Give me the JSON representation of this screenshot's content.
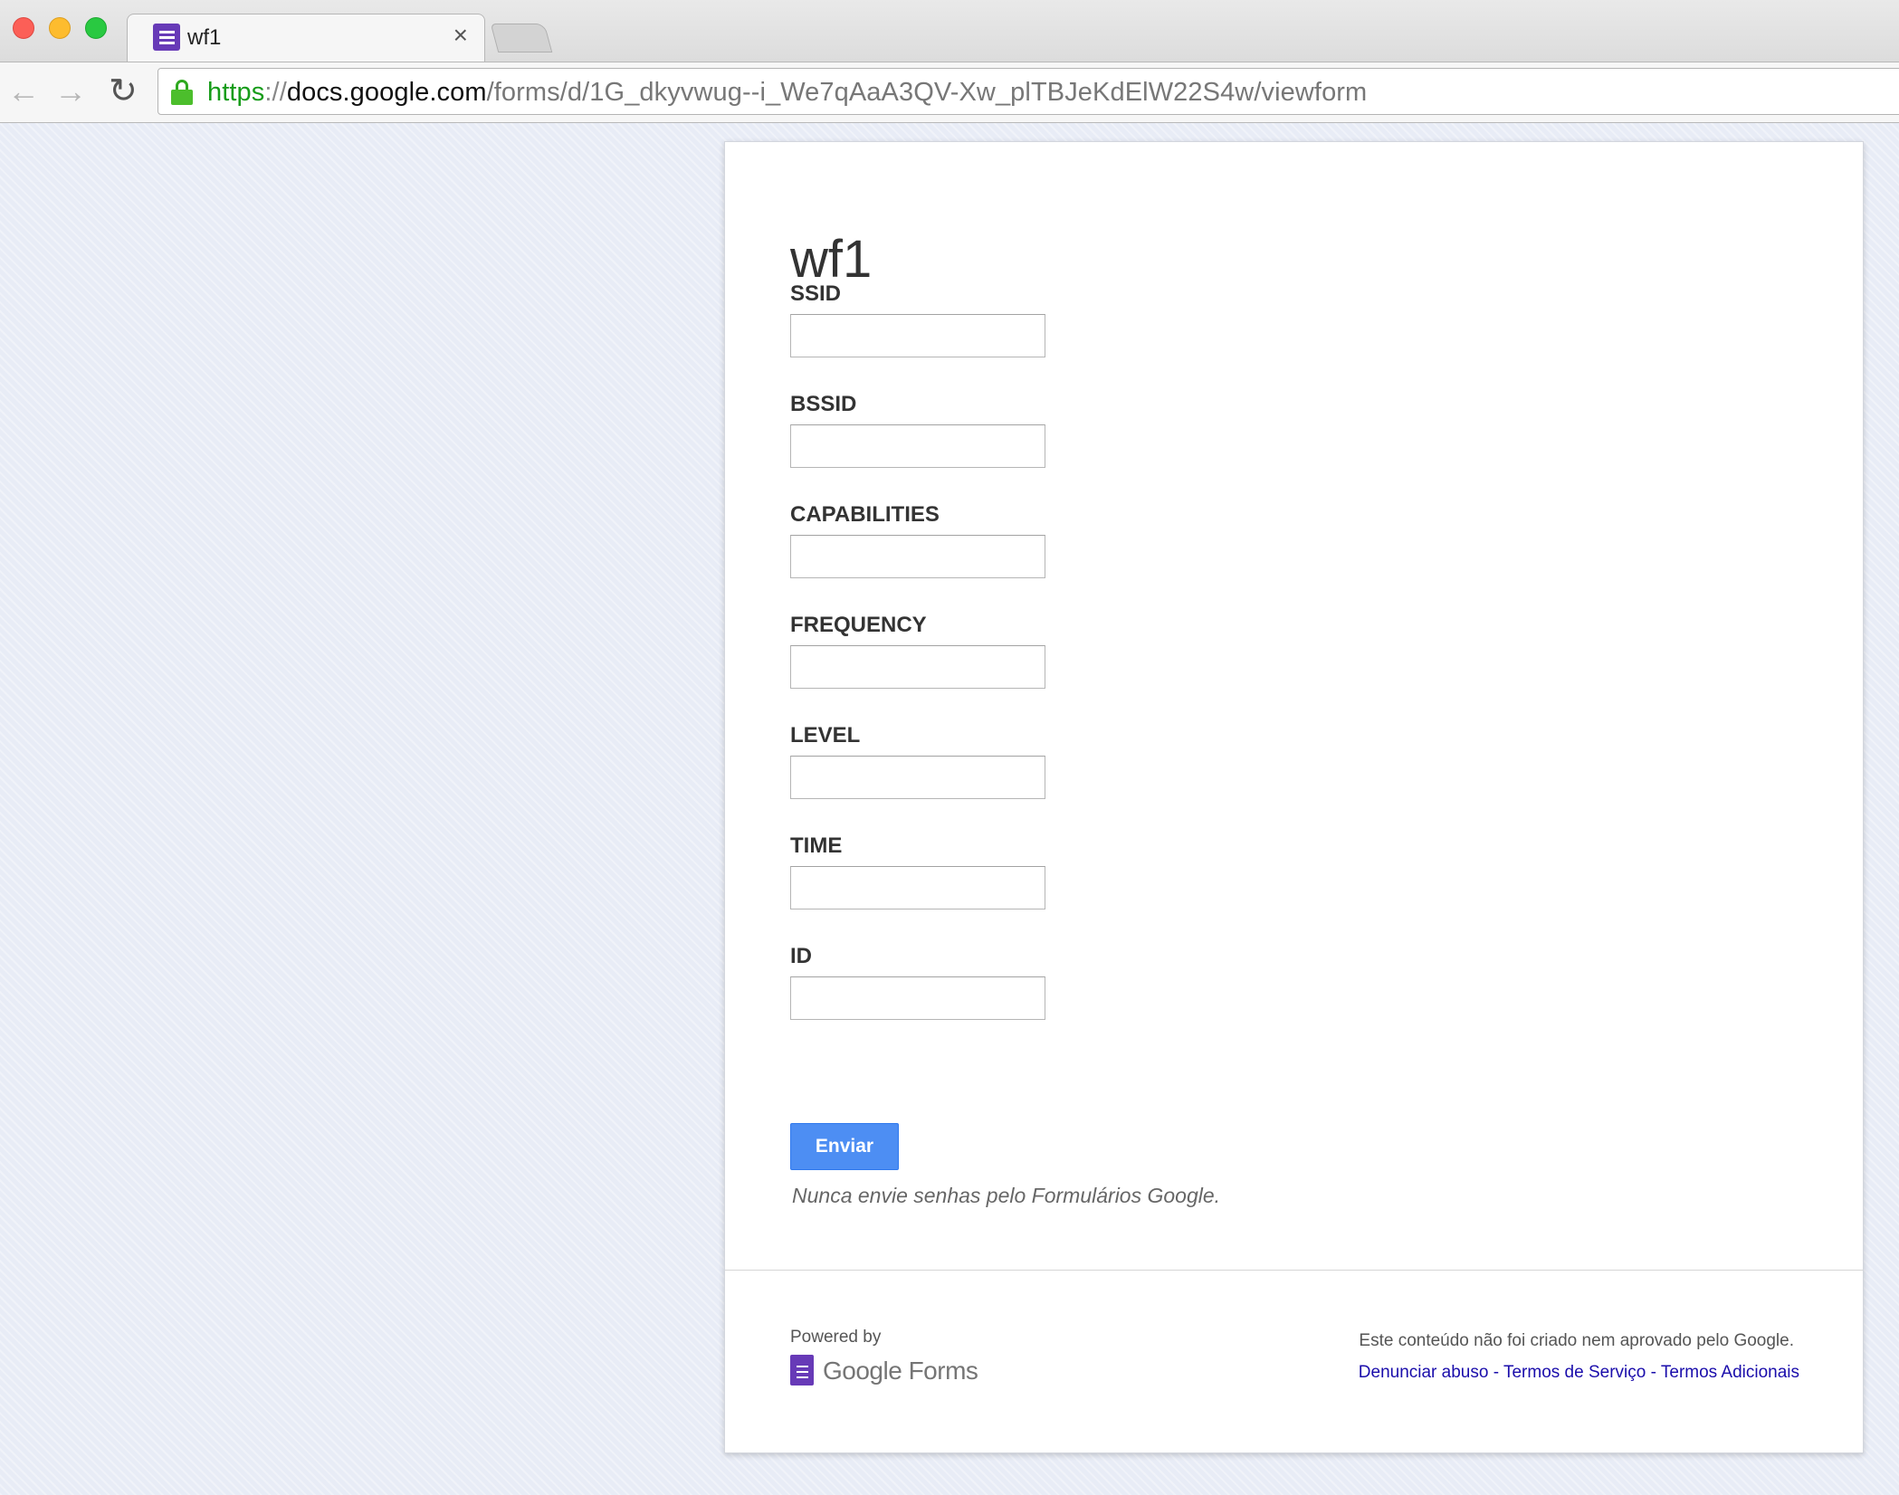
{
  "browser": {
    "tab_title": "wf1",
    "tab_close": "×",
    "url": {
      "scheme": "https",
      "separator": "://",
      "host": "docs.google.com",
      "path": "/forms/d/1G_dkyvwug--i_We7qAaA3QV-Xw_plTBJeKdElW22S4w/viewform"
    },
    "icons": {
      "back": "←",
      "forward": "→",
      "reload": "↻"
    }
  },
  "form": {
    "title": "wf1",
    "fields": [
      {
        "label": "SSID",
        "value": ""
      },
      {
        "label": "BSSID",
        "value": ""
      },
      {
        "label": "CAPABILITIES",
        "value": ""
      },
      {
        "label": "FREQUENCY",
        "value": ""
      },
      {
        "label": "LEVEL",
        "value": ""
      },
      {
        "label": "TIME",
        "value": ""
      },
      {
        "label": "ID",
        "value": ""
      }
    ],
    "submit_label": "Enviar",
    "password_warning": "Nunca envie senhas pelo Formulários Google."
  },
  "footer": {
    "powered_by": "Powered by",
    "logo_text": "Google Forms",
    "disclaimer": "Este conteúdo não foi criado nem aprovado pelo Google.",
    "links": {
      "report_abuse": "Denunciar abuso",
      "separator": " - ",
      "terms": "Termos de Serviço",
      "additional_terms": "Termos Adicionais"
    }
  },
  "colors": {
    "brand_purple": "#673ab7",
    "submit_blue": "#4d8ef3",
    "link_blue": "#1a0dab",
    "secure_green": "#179c1a"
  }
}
